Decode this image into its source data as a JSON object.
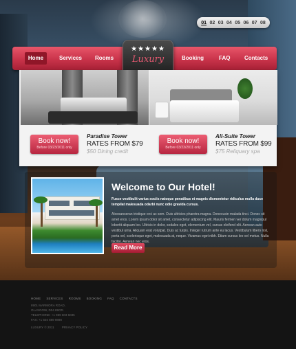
{
  "pager": {
    "pages": [
      "01",
      "02",
      "03",
      "04",
      "05",
      "06",
      "07",
      "08"
    ],
    "active": "01"
  },
  "nav": {
    "home": "Home",
    "services": "Services",
    "rooms": "Rooms",
    "booking": "Booking",
    "faq": "FAQ",
    "contacts": "Contacts"
  },
  "logo": {
    "stars": "★★★★★",
    "name": "Luxury"
  },
  "rooms": [
    {
      "book_label": "Book now!",
      "book_sub": "Before 03/23/2011 only",
      "name": "Paradise Tower",
      "rate": "RATES FROM $79",
      "extra": "$50 Dining credit"
    },
    {
      "book_label": "Book now!",
      "book_sub": "Before 03/23/2011 only",
      "name": "All-Suite Tower",
      "rate": "RATES FROM $99",
      "extra": "$75 Reliquary spa"
    }
  ],
  "welcome": {
    "title": "Welcome to Our Hotel!",
    "lead": "Fusce vestibulit varius sociis natoque penatibus et magnis dismontetur ridiculus mulla duce tempilat malesuada odarbi nunc odio gravida cursus.",
    "body": "Aloesanseran tristique orci ac sem. Duis ultricies pharetra magna. Donecusin malada tinci. Donec sit amet eros. Lorem ipsum dolor sit amet, consectetur adipiscing elit. Mauris fermen ver dolum magnipul lobortit aliquam leo. Ultricis in dolor, sodales eget, elementum vel, cursus eleifend elit. Aenean auto vestibul urna. Aliquam erat volutpat. Duis ac turpis. Integer rutrum ante eu lacus. Vestibulum libero nisl, porta vel, scelerisque eget, malesuada at, neque. Vivamus eget nibh. Etiam cursus leo vel metus. Nulla facilisi. Aenean nec eros.",
    "read_more": "Read More"
  },
  "footer": {
    "nav": [
      "HOME",
      "SERVICES",
      "ROOMS",
      "BOOKING",
      "FAQ",
      "CONTACTS"
    ],
    "address": [
      "8901 MARMORA ROAD,",
      "GLASGOW, D04 89GR.",
      "TELEPHONE:  +1 959 603 6035",
      "FAX:              +1 504 889 9898"
    ],
    "copyright": "LUXURY © 2011",
    "privacy": "PRIVACY POLICY"
  }
}
